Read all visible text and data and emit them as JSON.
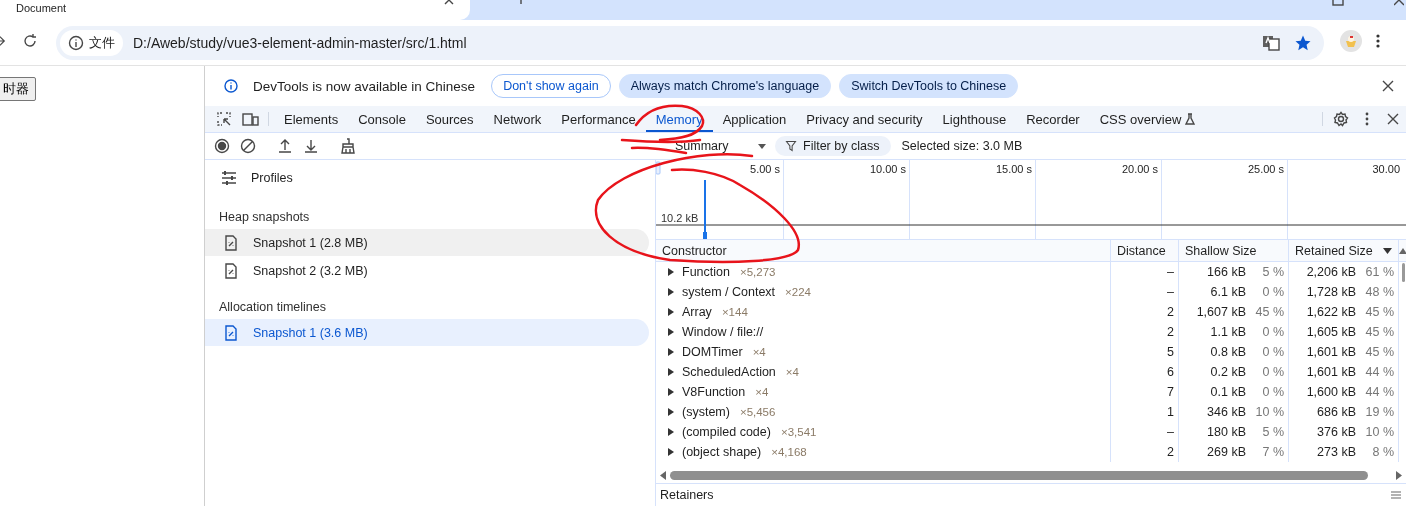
{
  "browser": {
    "tab_title": "Document",
    "address": {
      "scheme_label": "文件",
      "url": "D:/Aweb/study/vue3-element-admin-master/src/1.html"
    }
  },
  "page": {
    "button_label": "时器"
  },
  "devtools": {
    "infobar": {
      "message": "DevTools is now available in Chinese",
      "buttons": [
        {
          "label": "Don't show again",
          "kind": "outline"
        },
        {
          "label": "Always match Chrome's language",
          "kind": "filled"
        },
        {
          "label": "Switch DevTools to Chinese",
          "kind": "filled"
        }
      ]
    },
    "tabs": [
      {
        "label": "Elements",
        "selected": false
      },
      {
        "label": "Console",
        "selected": false
      },
      {
        "label": "Sources",
        "selected": false
      },
      {
        "label": "Network",
        "selected": false
      },
      {
        "label": "Performance",
        "selected": false
      },
      {
        "label": "Memory",
        "selected": true
      },
      {
        "label": "Application",
        "selected": false
      },
      {
        "label": "Privacy and security",
        "selected": false
      },
      {
        "label": "Lighthouse",
        "selected": false
      },
      {
        "label": "Recorder",
        "selected": false
      },
      {
        "label": "CSS overview",
        "selected": false
      }
    ],
    "toolbar": {
      "view": "Summary",
      "filter": "Filter by class",
      "selected_size": "Selected size: 3.0 MB"
    },
    "sidebar": {
      "title": "Profiles",
      "groups": [
        {
          "heading": "Heap snapshots",
          "items": [
            {
              "label": "Snapshot 1 (2.8 MB)",
              "selected": false,
              "hovered": true
            },
            {
              "label": "Snapshot 2 (3.2 MB)",
              "selected": false,
              "hovered": false
            }
          ]
        },
        {
          "heading": "Allocation timelines",
          "items": [
            {
              "label": "Snapshot 1 (3.6 MB)",
              "selected": true,
              "hovered": false
            }
          ]
        }
      ]
    },
    "timeline": {
      "ticks": [
        "5.00 s",
        "10.00 s",
        "15.00 s",
        "20.00 s",
        "25.00 s",
        "30.00"
      ],
      "scale_label": "10.2 kB"
    },
    "table": {
      "columns": [
        {
          "label": "Constructor",
          "sorted": false
        },
        {
          "label": "Distance",
          "sorted": false
        },
        {
          "label": "Shallow Size",
          "sorted": false
        },
        {
          "label": "Retained Size",
          "sorted": true
        }
      ],
      "rows": [
        {
          "name": "Function",
          "count": "×5,273",
          "distance": "–",
          "shallow": "166 kB",
          "shallow_pct": "5 %",
          "retained": "2,206 kB",
          "retained_pct": "61 %"
        },
        {
          "name": "system / Context",
          "count": "×224",
          "distance": "–",
          "shallow": "6.1 kB",
          "shallow_pct": "0 %",
          "retained": "1,728 kB",
          "retained_pct": "48 %"
        },
        {
          "name": "Array",
          "count": "×144",
          "distance": "2",
          "shallow": "1,607 kB",
          "shallow_pct": "45 %",
          "retained": "1,622 kB",
          "retained_pct": "45 %"
        },
        {
          "name": "Window / file://",
          "distance": "2",
          "shallow": "1.1 kB",
          "shallow_pct": "0 %",
          "retained": "1,605 kB",
          "retained_pct": "45 %"
        },
        {
          "name": "DOMTimer",
          "count": "×4",
          "distance": "5",
          "shallow": "0.8 kB",
          "shallow_pct": "0 %",
          "retained": "1,601 kB",
          "retained_pct": "45 %"
        },
        {
          "name": "ScheduledAction",
          "count": "×4",
          "distance": "6",
          "shallow": "0.2 kB",
          "shallow_pct": "0 %",
          "retained": "1,601 kB",
          "retained_pct": "44 %"
        },
        {
          "name": "V8Function",
          "count": "×4",
          "distance": "7",
          "shallow": "0.1 kB",
          "shallow_pct": "0 %",
          "retained": "1,600 kB",
          "retained_pct": "44 %"
        },
        {
          "name": "(system)",
          "count": "×5,456",
          "distance": "1",
          "shallow": "346 kB",
          "shallow_pct": "10 %",
          "retained": "686 kB",
          "retained_pct": "19 %"
        },
        {
          "name": "(compiled code)",
          "count": "×3,541",
          "distance": "–",
          "shallow": "180 kB",
          "shallow_pct": "5 %",
          "retained": "376 kB",
          "retained_pct": "10 %"
        },
        {
          "name": "(object shape)",
          "count": "×4,168",
          "distance": "2",
          "shallow": "269 kB",
          "shallow_pct": "7 %",
          "retained": "273 kB",
          "retained_pct": "8 %"
        }
      ]
    },
    "retainers": "Retainers"
  }
}
